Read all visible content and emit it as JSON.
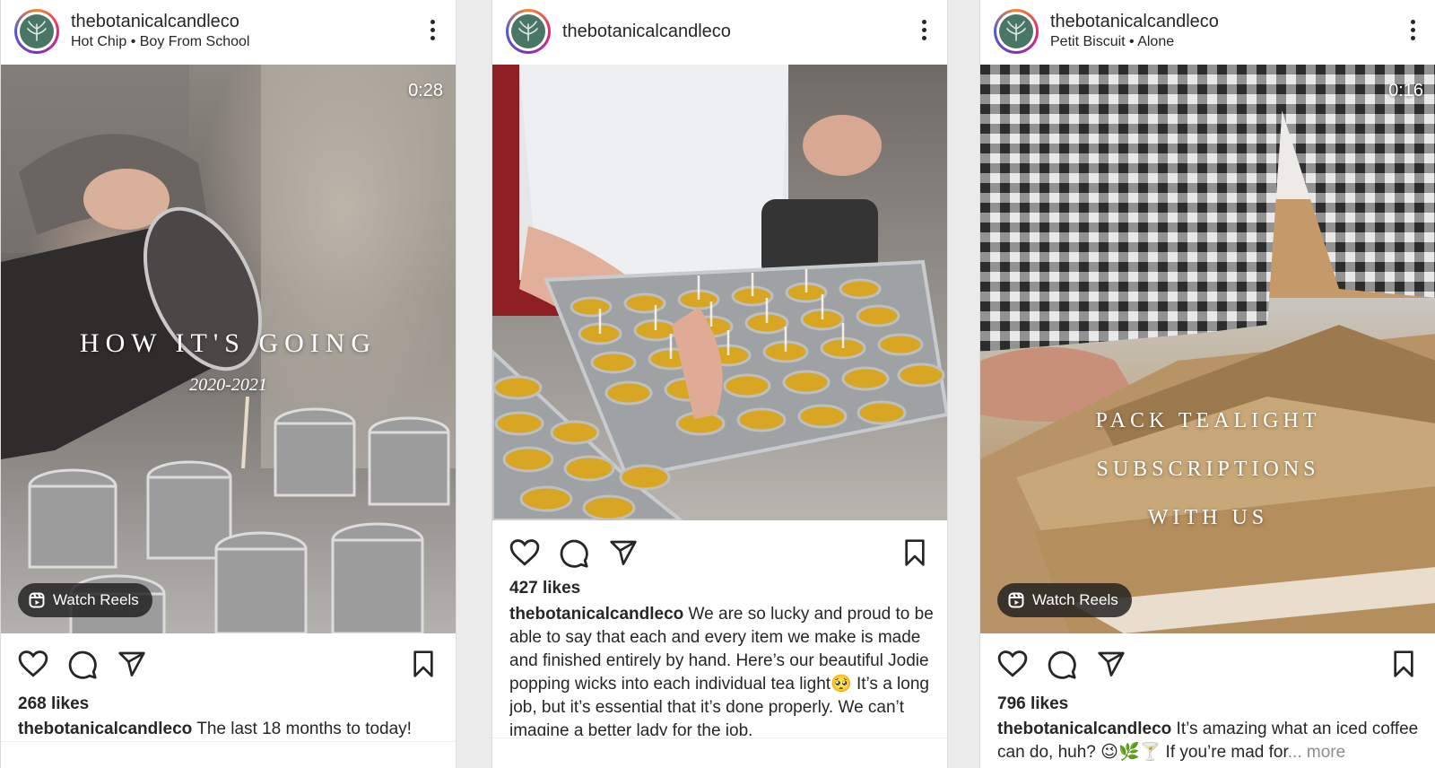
{
  "posts": [
    {
      "username": "thebotanicalcandleco",
      "audio": "Hot Chip • Boy From School",
      "duration": "0:28",
      "overlay_lines": [
        "HOW IT'S GOING",
        "2020-2021"
      ],
      "watch_label": "Watch Reels",
      "likes": "268 likes",
      "caption_user": "thebotanicalcandleco",
      "caption_text": " The last 18 months to today!"
    },
    {
      "username": "thebotanicalcandleco",
      "likes": "427 likes",
      "caption_user": "thebotanicalcandleco",
      "caption_text": " We are so lucky and proud to be able to say that each and every item we make is made and finished entirely by hand. Here’s our beautiful Jodie popping wicks into each individual tea light🥺 It’s a long job, but it’s essential that it’s done properly. We can’t imagine a better lady for the job."
    },
    {
      "username": "thebotanicalcandleco",
      "audio": "Petit Biscuit • Alone",
      "duration": "0:16",
      "overlay_lines": [
        "PACK TEALIGHT",
        "SUBSCRIPTIONS",
        "WITH US"
      ],
      "watch_label": "Watch Reels",
      "likes": "796 likes",
      "caption_user": "thebotanicalcandleco",
      "caption_text": " It’s amazing what an iced coffee can do, huh? 😉🌿🍸 If you’re mad for",
      "caption_more": "... more"
    }
  ],
  "icons": [
    "heart-icon",
    "comment-icon",
    "share-icon",
    "bookmark-icon",
    "more-options-icon",
    "reels-icon"
  ]
}
